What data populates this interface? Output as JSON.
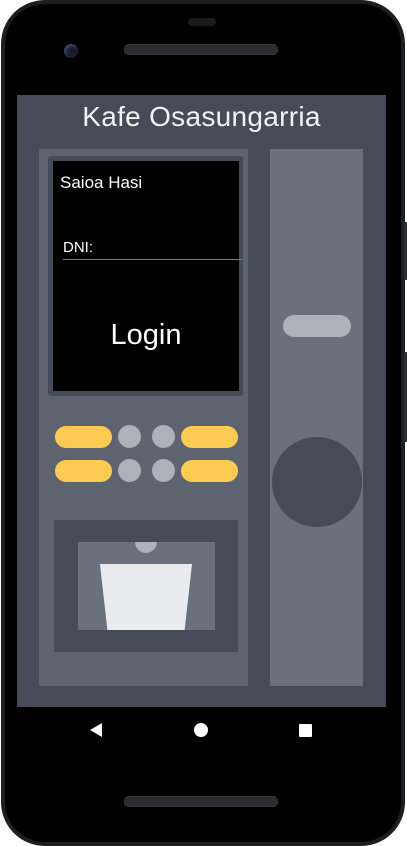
{
  "app": {
    "title": "Kafe Osasungarria"
  },
  "login_panel": {
    "heading": "Saioa Hasi",
    "dni_label": "DNI:",
    "dni_value": "",
    "login_label": "Login"
  },
  "colors": {
    "screen_background": "#464c57",
    "machine_body": "#5d646f",
    "machine_side": "#6b717c",
    "button_yellow": "#fecb52",
    "button_gray": "#adb1ba",
    "input_underline": "#14a394",
    "display": "#000000"
  },
  "icons": {
    "nav_back": "triangle-left",
    "nav_home": "circle",
    "nav_recent": "square"
  }
}
